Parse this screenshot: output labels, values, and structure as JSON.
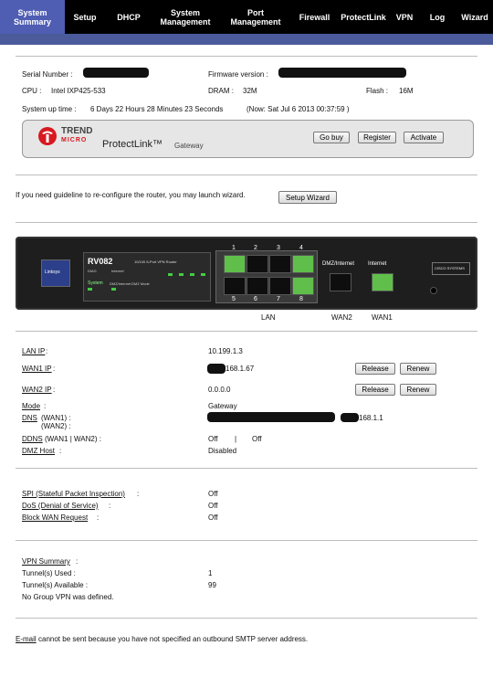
{
  "nav": {
    "tabs": [
      {
        "label1": "System",
        "label2": "Summary"
      },
      {
        "label1": "Setup",
        "label2": ""
      },
      {
        "label1": "DHCP",
        "label2": ""
      },
      {
        "label1": "System",
        "label2": "Management"
      },
      {
        "label1": "Port",
        "label2": "Management"
      },
      {
        "label1": "Firewall",
        "label2": ""
      },
      {
        "label1": "ProtectLink",
        "label2": ""
      },
      {
        "label1": "VPN",
        "label2": ""
      },
      {
        "label1": "Log",
        "label2": ""
      },
      {
        "label1": "Wizard",
        "label2": ""
      }
    ]
  },
  "info": {
    "serial_label": "Serial Number :",
    "firmware_label": "Firmware version :",
    "cpu_label": "CPU :",
    "cpu_value": "Intel IXP425-533",
    "dram_label": "DRAM :",
    "dram_value": "32M",
    "flash_label": "Flash :",
    "flash_value": "16M",
    "uptime_label": "System up time :",
    "uptime_value": "6 Days 22 Hours 28 Minutes 23 Seconds",
    "now_value": "(Now: Sat Jul 6 2013 00:37:59 )"
  },
  "protectlink": {
    "brand1": "TREND",
    "brand2": "MICRO",
    "title": "ProtectLink™",
    "subtitle": "Gateway",
    "go_buy": "Go buy",
    "register": "Register",
    "activate": "Activate"
  },
  "wizard": {
    "text": "If you need guideline to re-configure the router, you may launch wizard.",
    "button": "Setup Wizard"
  },
  "router": {
    "model": "RV082",
    "desc": "10/100 8-Port VPN Router",
    "brand_left": "Linksys",
    "brand_right": "CISCO SYSTEMS",
    "dmz_label": "DMZ/Internet",
    "internet_label": "Internet",
    "port_top": [
      "1",
      "2",
      "3",
      "4"
    ],
    "port_bottom": [
      "5",
      "6",
      "7",
      "8"
    ],
    "lan_label": "LAN",
    "wan2_label": "WAN2",
    "wan1_label": "WAN1",
    "led_labels": {
      "diag": "DIAG",
      "internet": "Internet",
      "system": "System",
      "dmz_internet": "DMZ/Internet",
      "dmz_mode": "DMZ Mode"
    }
  },
  "network": {
    "lan_ip_label": "LAN IP",
    "lan_ip_value": "10.199.1.3",
    "wan1_ip_label": "WAN1 IP",
    "wan1_ip_value": "168.1.67",
    "wan2_ip_label": "WAN2 IP",
    "wan2_ip_value": "0.0.0.0",
    "release": "Release",
    "renew": "Renew",
    "mode_label": "Mode",
    "mode_value": "Gateway",
    "dns_label": "DNS",
    "dns_wan1": "(WAN1) :",
    "dns_wan2": "(WAN2) :",
    "dns_value": "168.1.1",
    "ddns_label": "DDNS",
    "ddns_sub": "(WAN1   |   WAN2) :",
    "ddns_value1": "Off",
    "ddns_sep": "|",
    "ddns_value2": "Off",
    "dmz_label": "DMZ Host",
    "dmz_value": "Disabled"
  },
  "security": {
    "spi_label": "SPI (Stateful Packet Inspection)",
    "spi_value": "Off",
    "dos_label": "DoS (Denial of Service)",
    "dos_value": "Off",
    "block_label": "Block WAN Request",
    "block_value": "Off"
  },
  "vpn": {
    "summary_label": "VPN Summary",
    "used_label": "Tunnel(s) Used :",
    "used_value": "1",
    "available_label": "Tunnel(s) Available :",
    "available_value": "99",
    "group_text": "No Group VPN was defined."
  },
  "email": {
    "link": "E-mail",
    "text": "cannot be sent because you have not specified an outbound SMTP server address."
  },
  "colors": {
    "nav_bg": "#000000",
    "nav_active": "#4f5db2",
    "accent_bar": "#4a5a9a",
    "port_green": "#5fbf4a"
  }
}
